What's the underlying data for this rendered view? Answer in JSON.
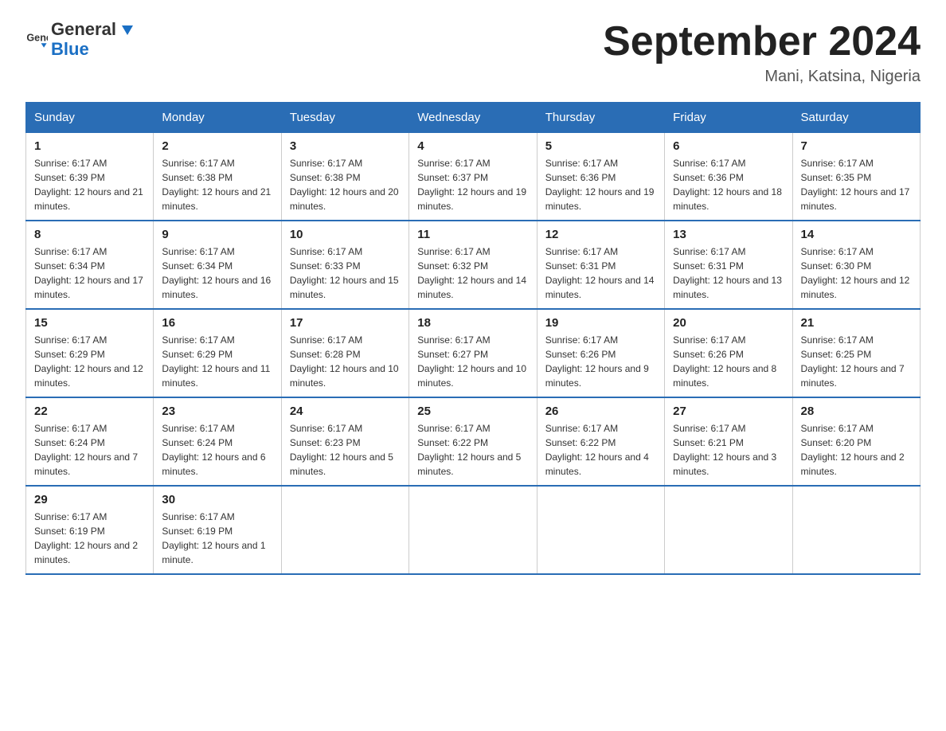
{
  "header": {
    "logo_general": "General",
    "logo_blue": "Blue",
    "month_title": "September 2024",
    "location": "Mani, Katsina, Nigeria"
  },
  "days_of_week": [
    "Sunday",
    "Monday",
    "Tuesday",
    "Wednesday",
    "Thursday",
    "Friday",
    "Saturday"
  ],
  "weeks": [
    [
      {
        "day": "1",
        "sunrise": "6:17 AM",
        "sunset": "6:39 PM",
        "daylight": "12 hours and 21 minutes."
      },
      {
        "day": "2",
        "sunrise": "6:17 AM",
        "sunset": "6:38 PM",
        "daylight": "12 hours and 21 minutes."
      },
      {
        "day": "3",
        "sunrise": "6:17 AM",
        "sunset": "6:38 PM",
        "daylight": "12 hours and 20 minutes."
      },
      {
        "day": "4",
        "sunrise": "6:17 AM",
        "sunset": "6:37 PM",
        "daylight": "12 hours and 19 minutes."
      },
      {
        "day": "5",
        "sunrise": "6:17 AM",
        "sunset": "6:36 PM",
        "daylight": "12 hours and 19 minutes."
      },
      {
        "day": "6",
        "sunrise": "6:17 AM",
        "sunset": "6:36 PM",
        "daylight": "12 hours and 18 minutes."
      },
      {
        "day": "7",
        "sunrise": "6:17 AM",
        "sunset": "6:35 PM",
        "daylight": "12 hours and 17 minutes."
      }
    ],
    [
      {
        "day": "8",
        "sunrise": "6:17 AM",
        "sunset": "6:34 PM",
        "daylight": "12 hours and 17 minutes."
      },
      {
        "day": "9",
        "sunrise": "6:17 AM",
        "sunset": "6:34 PM",
        "daylight": "12 hours and 16 minutes."
      },
      {
        "day": "10",
        "sunrise": "6:17 AM",
        "sunset": "6:33 PM",
        "daylight": "12 hours and 15 minutes."
      },
      {
        "day": "11",
        "sunrise": "6:17 AM",
        "sunset": "6:32 PM",
        "daylight": "12 hours and 14 minutes."
      },
      {
        "day": "12",
        "sunrise": "6:17 AM",
        "sunset": "6:31 PM",
        "daylight": "12 hours and 14 minutes."
      },
      {
        "day": "13",
        "sunrise": "6:17 AM",
        "sunset": "6:31 PM",
        "daylight": "12 hours and 13 minutes."
      },
      {
        "day": "14",
        "sunrise": "6:17 AM",
        "sunset": "6:30 PM",
        "daylight": "12 hours and 12 minutes."
      }
    ],
    [
      {
        "day": "15",
        "sunrise": "6:17 AM",
        "sunset": "6:29 PM",
        "daylight": "12 hours and 12 minutes."
      },
      {
        "day": "16",
        "sunrise": "6:17 AM",
        "sunset": "6:29 PM",
        "daylight": "12 hours and 11 minutes."
      },
      {
        "day": "17",
        "sunrise": "6:17 AM",
        "sunset": "6:28 PM",
        "daylight": "12 hours and 10 minutes."
      },
      {
        "day": "18",
        "sunrise": "6:17 AM",
        "sunset": "6:27 PM",
        "daylight": "12 hours and 10 minutes."
      },
      {
        "day": "19",
        "sunrise": "6:17 AM",
        "sunset": "6:26 PM",
        "daylight": "12 hours and 9 minutes."
      },
      {
        "day": "20",
        "sunrise": "6:17 AM",
        "sunset": "6:26 PM",
        "daylight": "12 hours and 8 minutes."
      },
      {
        "day": "21",
        "sunrise": "6:17 AM",
        "sunset": "6:25 PM",
        "daylight": "12 hours and 7 minutes."
      }
    ],
    [
      {
        "day": "22",
        "sunrise": "6:17 AM",
        "sunset": "6:24 PM",
        "daylight": "12 hours and 7 minutes."
      },
      {
        "day": "23",
        "sunrise": "6:17 AM",
        "sunset": "6:24 PM",
        "daylight": "12 hours and 6 minutes."
      },
      {
        "day": "24",
        "sunrise": "6:17 AM",
        "sunset": "6:23 PM",
        "daylight": "12 hours and 5 minutes."
      },
      {
        "day": "25",
        "sunrise": "6:17 AM",
        "sunset": "6:22 PM",
        "daylight": "12 hours and 5 minutes."
      },
      {
        "day": "26",
        "sunrise": "6:17 AM",
        "sunset": "6:22 PM",
        "daylight": "12 hours and 4 minutes."
      },
      {
        "day": "27",
        "sunrise": "6:17 AM",
        "sunset": "6:21 PM",
        "daylight": "12 hours and 3 minutes."
      },
      {
        "day": "28",
        "sunrise": "6:17 AM",
        "sunset": "6:20 PM",
        "daylight": "12 hours and 2 minutes."
      }
    ],
    [
      {
        "day": "29",
        "sunrise": "6:17 AM",
        "sunset": "6:19 PM",
        "daylight": "12 hours and 2 minutes."
      },
      {
        "day": "30",
        "sunrise": "6:17 AM",
        "sunset": "6:19 PM",
        "daylight": "12 hours and 1 minute."
      },
      null,
      null,
      null,
      null,
      null
    ]
  ]
}
